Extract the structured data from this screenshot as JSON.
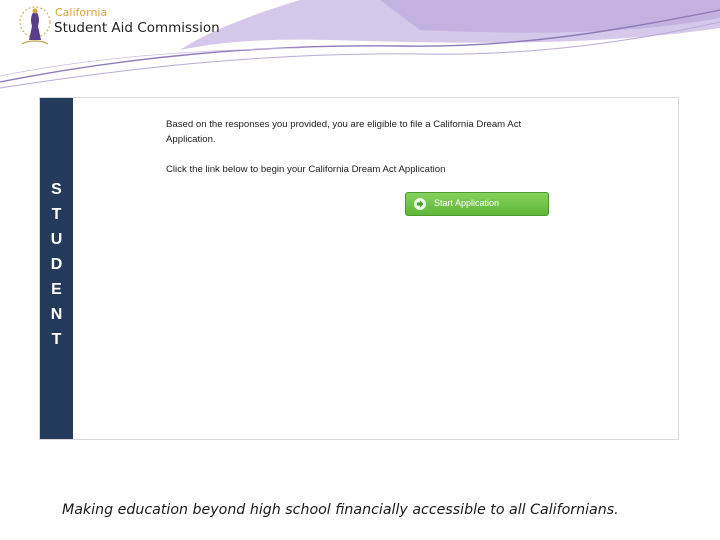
{
  "header": {
    "org_small": "California",
    "org_main": "Student Aid Commission"
  },
  "panel": {
    "side_label": [
      "S",
      "T",
      "U",
      "D",
      "E",
      "N",
      "T"
    ],
    "message_1": "Based on the responses you provided, you are eligible to file a California Dream Act Application.",
    "message_2": "Click the link below to begin your California Dream Act Application",
    "start_button_label": "Start Application"
  },
  "footer": {
    "tagline": "Making education beyond high school financially accessible to all Californians."
  },
  "colors": {
    "side_bar": "#243a5a",
    "button_green": "#5fb63a",
    "org_gold": "#d9a73b"
  },
  "icons": [
    "seal-logo-icon",
    "arrow-right-icon"
  ]
}
